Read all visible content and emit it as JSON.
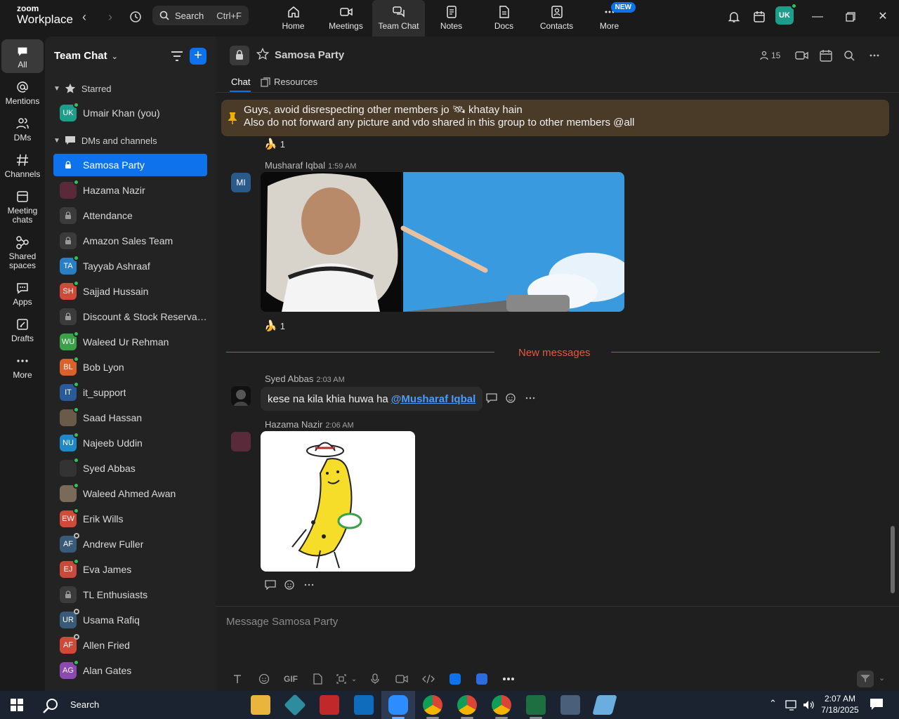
{
  "app": {
    "logo_small": "zoom",
    "logo_big": "Workplace",
    "search_label": "Search",
    "search_shortcut": "Ctrl+F"
  },
  "nav_tabs": [
    {
      "label": "Home",
      "icon": "home-icon"
    },
    {
      "label": "Meetings",
      "icon": "video-icon"
    },
    {
      "label": "Team Chat",
      "icon": "chat-icon"
    },
    {
      "label": "Notes",
      "icon": "notes-icon"
    },
    {
      "label": "Docs",
      "icon": "docs-icon"
    },
    {
      "label": "Contacts",
      "icon": "contacts-icon"
    },
    {
      "label": "More",
      "icon": "more-icon"
    }
  ],
  "nav_badge": "NEW",
  "user_initials": "UK",
  "rail": [
    {
      "label": "All"
    },
    {
      "label": "Mentions"
    },
    {
      "label": "DMs"
    },
    {
      "label": "Channels"
    },
    {
      "label": "Meeting chats"
    },
    {
      "label": "Shared spaces"
    },
    {
      "label": "Apps"
    },
    {
      "label": "Drafts"
    },
    {
      "label": "More"
    }
  ],
  "sidebar": {
    "title": "Team Chat",
    "starred_header": "Starred",
    "starred": [
      {
        "label": "Umair Khan (you)",
        "initials": "UK",
        "color": "#1e9d8b",
        "status": "on"
      }
    ],
    "dms_header": "DMs and channels",
    "items": [
      {
        "label": "Samosa Party",
        "initials": "",
        "type": "lock",
        "active": true
      },
      {
        "label": "Hazama Nazir",
        "initials": "",
        "type": "photo",
        "color": "#5a2a3a",
        "status": "on"
      },
      {
        "label": "Attendance",
        "initials": "",
        "type": "lock"
      },
      {
        "label": "Amazon Sales Team",
        "initials": "",
        "type": "lock"
      },
      {
        "label": "Tayyab Ashraaf",
        "initials": "TA",
        "color": "#2a7ec4",
        "status": "on"
      },
      {
        "label": "Sajjad Hussain",
        "initials": "SH",
        "color": "#d04a3a",
        "status": "on"
      },
      {
        "label": "Discount & Stock Reservati...",
        "initials": "",
        "type": "lock"
      },
      {
        "label": "Waleed Ur Rehman",
        "initials": "WU",
        "color": "#3aa04a",
        "status": "on"
      },
      {
        "label": "Bob Lyon",
        "initials": "BL",
        "color": "#d9622b",
        "status": "on"
      },
      {
        "label": "it_support",
        "initials": "IT",
        "color": "#2a5a9a",
        "status": "on"
      },
      {
        "label": "Saad Hassan",
        "initials": "",
        "type": "photo",
        "color": "#6a5a4a",
        "status": "on"
      },
      {
        "label": "Najeeb Uddin",
        "initials": "NU",
        "color": "#1e88c8",
        "status": "on"
      },
      {
        "label": "Syed Abbas",
        "initials": "",
        "type": "photo",
        "color": "#333333",
        "status": "on"
      },
      {
        "label": "Waleed Ahmed Awan",
        "initials": "",
        "type": "photo",
        "color": "#7a6a5a",
        "status": "on"
      },
      {
        "label": "Erik Wills",
        "initials": "EW",
        "color": "#d04a3a",
        "status": "on"
      },
      {
        "label": "Andrew Fuller",
        "initials": "AF",
        "color": "#3a5a7a",
        "status": "away"
      },
      {
        "label": "Eva James",
        "initials": "EJ",
        "color": "#c84a3a",
        "status": "on"
      },
      {
        "label": "TL Enthusiasts",
        "initials": "",
        "type": "lock"
      },
      {
        "label": "Usama Rafiq",
        "initials": "UR",
        "color": "#3a5a7a",
        "status": "away"
      },
      {
        "label": "Allen Fried",
        "initials": "AF",
        "color": "#d04a3a",
        "status": "away"
      },
      {
        "label": "Alan Gates",
        "initials": "AG",
        "color": "#8a4ab0",
        "status": "on"
      }
    ]
  },
  "channel": {
    "name": "Samosa Party",
    "member_count": "15",
    "tabs": [
      "Chat",
      "Resources"
    ],
    "pinned_line1": "Guys, avoid disrespecting other members jo 🛰 khatay hain",
    "pinned_line2": "Also do not forward any picture and vdo shared in this group to other members @all"
  },
  "messages": [
    {
      "reaction": "🍌",
      "count": "1"
    },
    {
      "sender": "Musharaf Iqbal",
      "time": "1:59 AM",
      "initials": "MI",
      "reaction": "🍌",
      "count": "1"
    },
    {
      "sender": "Syed Abbas",
      "time": "2:03 AM",
      "text": "kese na kila khia huwa ha",
      "mention": "@Musharaf Iqbal"
    },
    {
      "sender": "Hazama Nazir",
      "time": "2:06 AM"
    }
  ],
  "new_messages_label": "New messages",
  "composer": {
    "placeholder": "Message Samosa Party",
    "gif_label": "GIF"
  },
  "taskbar": {
    "search_label": "Search",
    "time": "2:07 AM",
    "date": "7/18/2025"
  }
}
